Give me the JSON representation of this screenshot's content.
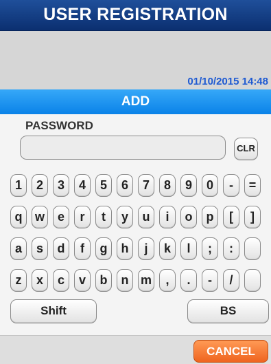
{
  "header": {
    "title": "USER REGISTRATION"
  },
  "status": {
    "datetime": "01/10/2015 14:48"
  },
  "mode": {
    "label": "ADD"
  },
  "password": {
    "label": "PASSWORD",
    "value": "",
    "placeholder": ""
  },
  "clear_button": {
    "label": "CLR"
  },
  "keyboard": {
    "row1": [
      "1",
      "2",
      "3",
      "4",
      "5",
      "6",
      "7",
      "8",
      "9",
      "0",
      "-",
      "="
    ],
    "row2": [
      "q",
      "w",
      "e",
      "r",
      "t",
      "y",
      "u",
      "i",
      "o",
      "p",
      "[",
      "]"
    ],
    "row3": [
      "a",
      "s",
      "d",
      "f",
      "g",
      "h",
      "j",
      "k",
      "l",
      ";",
      ":",
      ""
    ],
    "row4": [
      "z",
      "x",
      "c",
      "v",
      "b",
      "n",
      "m",
      ",",
      ".",
      "-",
      "/",
      ""
    ],
    "shift_label": "Shift",
    "backspace_label": "BS"
  },
  "footer": {
    "cancel_label": "CANCEL"
  },
  "colors": {
    "title_bar": "#0b2f70",
    "mode_bar": "#1591f0",
    "datetime_text": "#1e5ad2",
    "cancel_button": "#ef641f"
  }
}
